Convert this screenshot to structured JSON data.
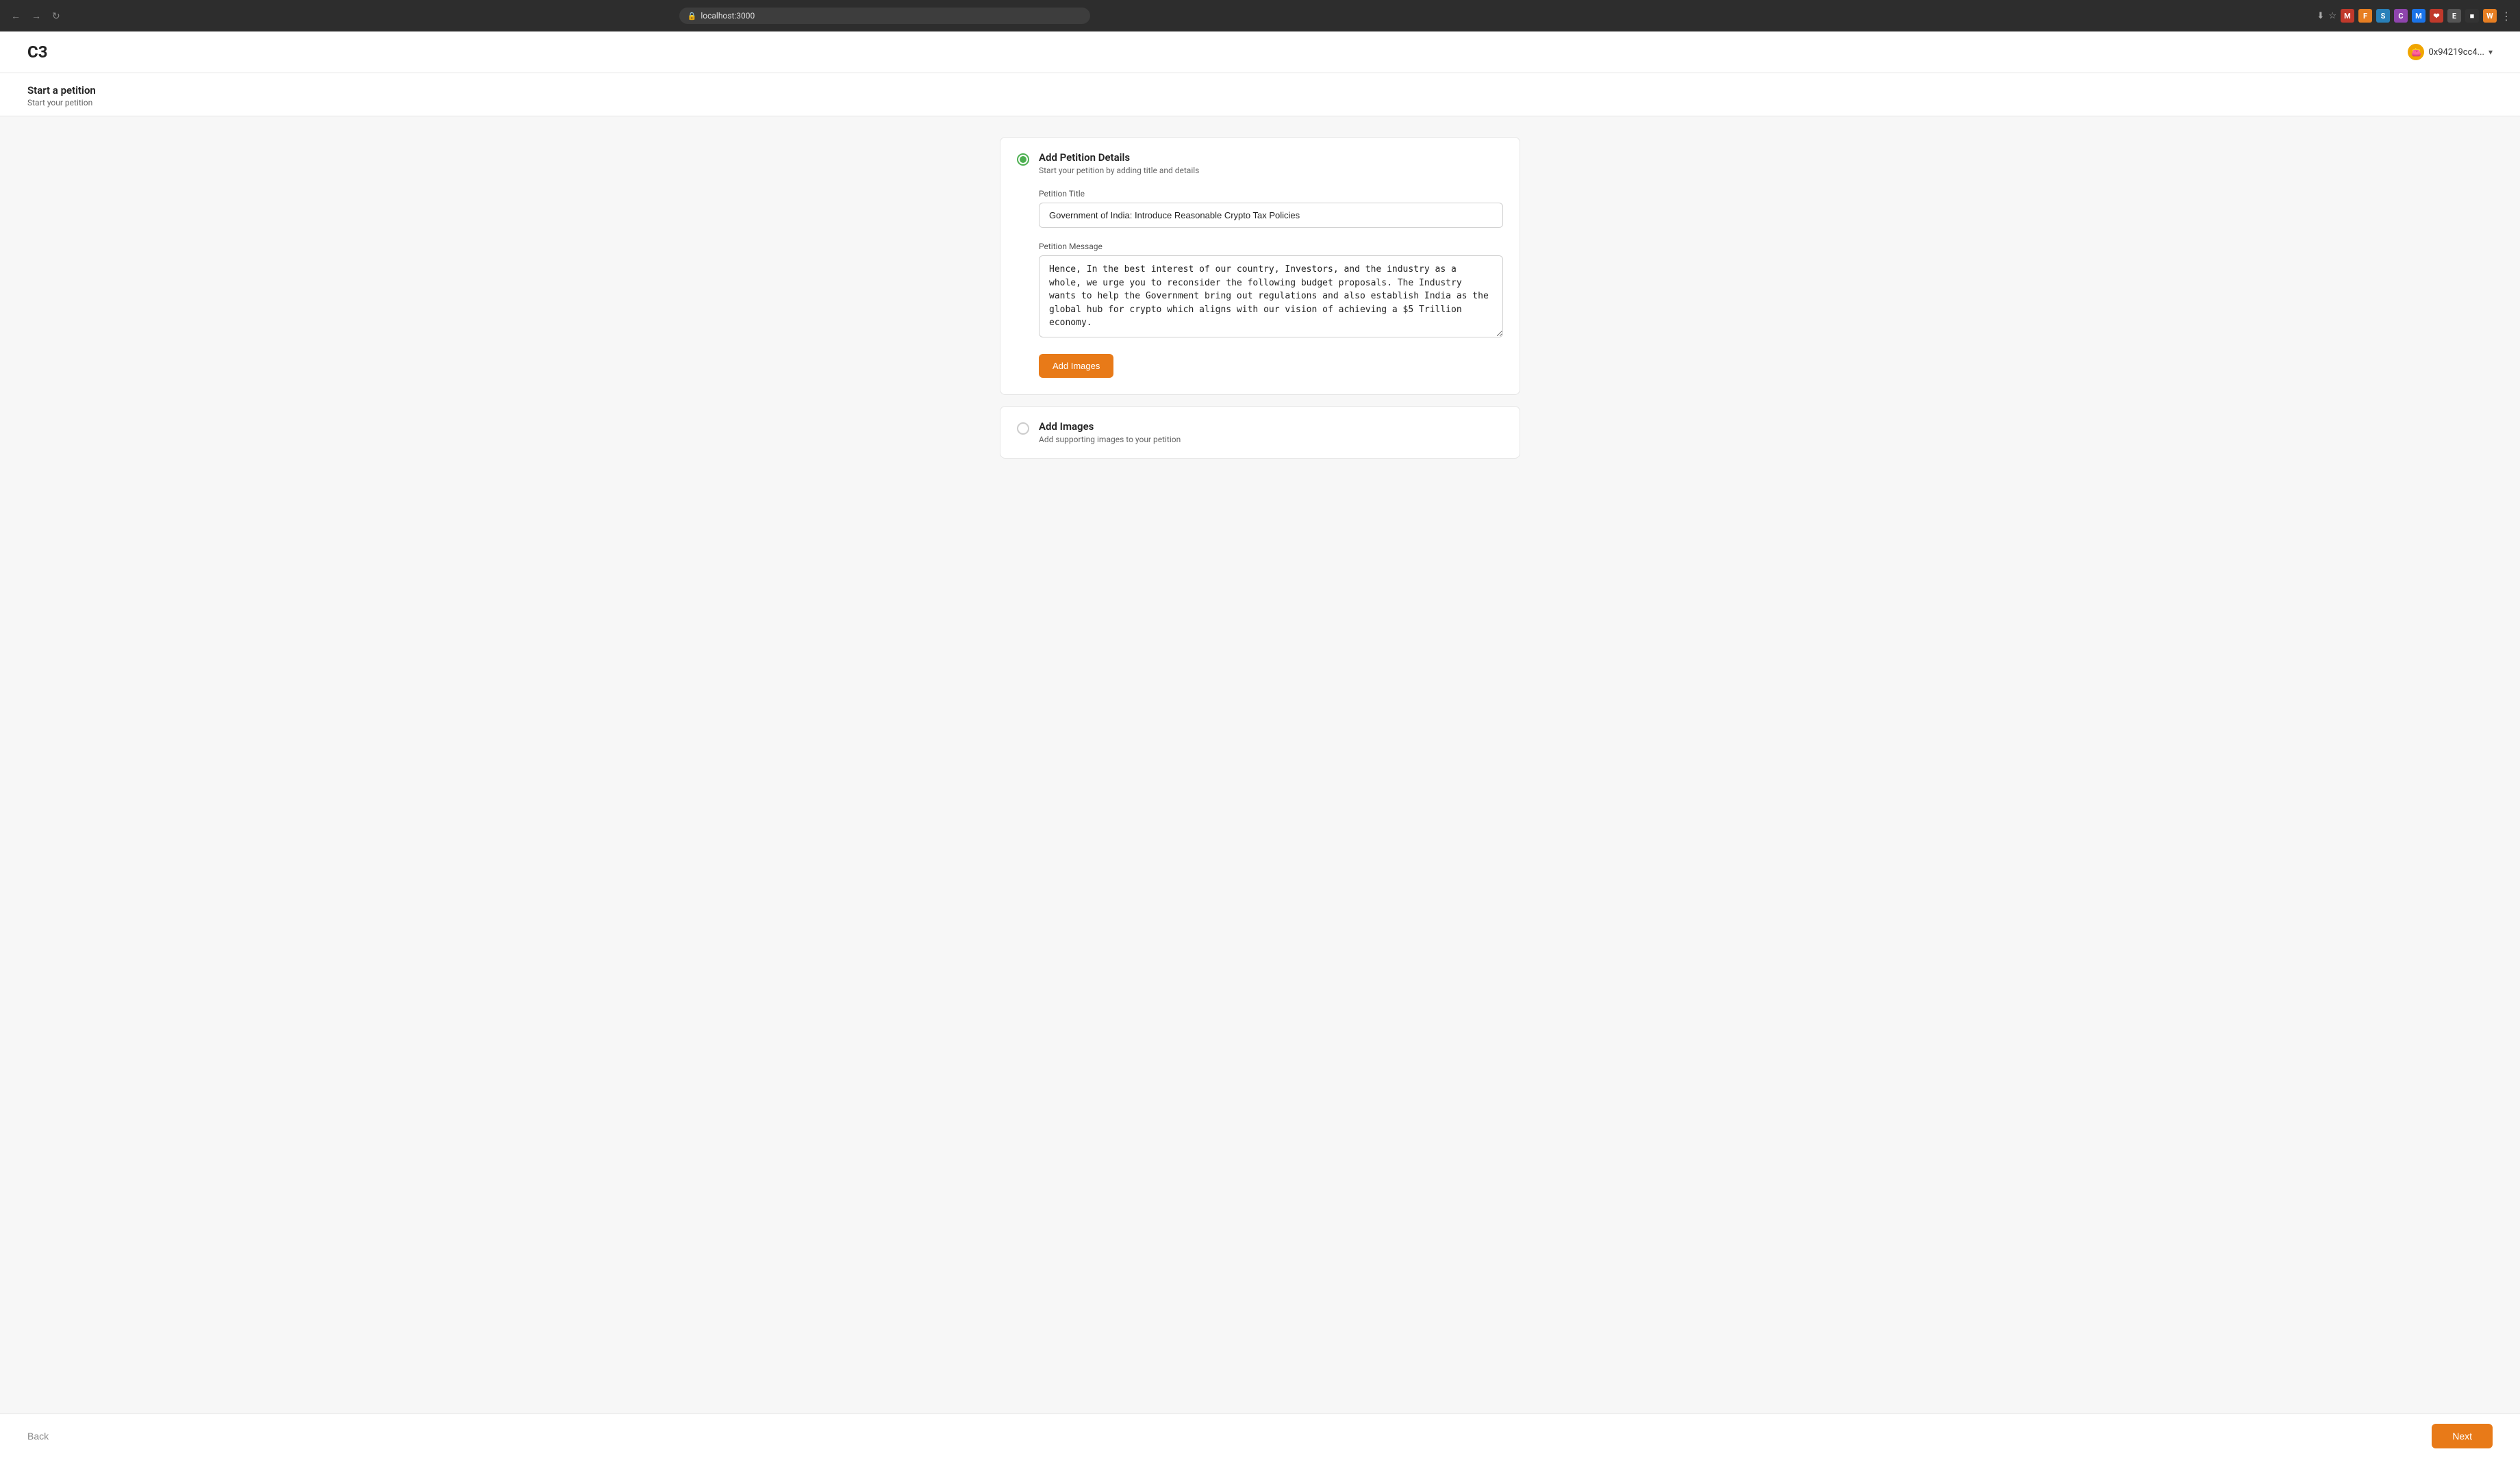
{
  "browser": {
    "url": "localhost:3000",
    "nav": {
      "back": "←",
      "forward": "→",
      "refresh": "↺"
    }
  },
  "header": {
    "logo": "C3",
    "wallet_address": "0x94219cc4...",
    "wallet_chevron": "▾"
  },
  "breadcrumb": {
    "title": "Start a petition",
    "subtitle": "Start your petition"
  },
  "sections": [
    {
      "id": "petition-details",
      "active": true,
      "title": "Add Petition Details",
      "description": "Start your petition by adding title and details",
      "fields": {
        "title_label": "Petition Title",
        "title_value": "Government of India: Introduce Reasonable Crypto Tax Policies",
        "message_label": "Petition Message",
        "message_value": "Hence, In the best interest of our country, Investors, and the industry as a whole, we urge you to reconsider the following budget proposals. The Industry wants to help the Government bring out regulations and also establish India as the global hub for crypto which aligns with our vision of achieving a $5 Trillion economy."
      },
      "add_images_btn": "Add Images"
    },
    {
      "id": "add-images",
      "active": false,
      "title": "Add Images",
      "description": "Add supporting images to your petition"
    }
  ],
  "footer": {
    "back_label": "Back",
    "next_label": "Next"
  }
}
